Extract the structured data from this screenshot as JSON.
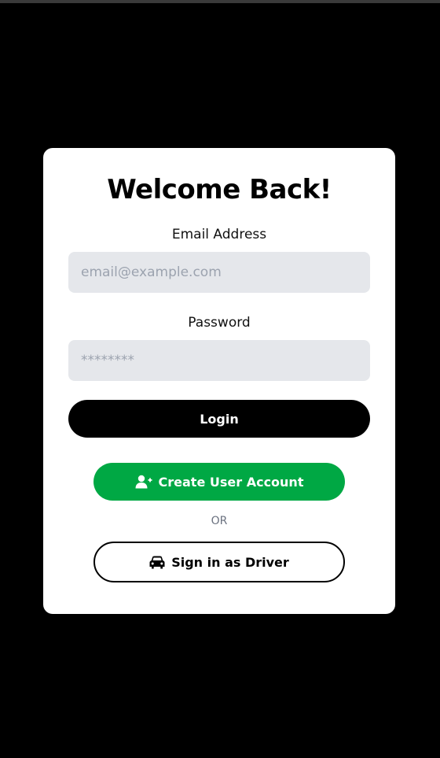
{
  "form": {
    "title": "Welcome Back!",
    "email_label": "Email Address",
    "email_placeholder": "email@example.com",
    "email_value": "",
    "password_label": "Password",
    "password_placeholder": "********",
    "password_value": "",
    "login_label": "Login",
    "create_account_label": "Create User Account",
    "or_label": "OR",
    "driver_label": "Sign in as Driver"
  },
  "icons": {
    "create_account": "user-plus-icon",
    "driver": "car-icon"
  },
  "colors": {
    "background": "#000000",
    "card": "#ffffff",
    "input_bg": "#e5e7eb",
    "login_button": "#000000",
    "create_button": "#00a844",
    "or_text": "#6b7280"
  }
}
